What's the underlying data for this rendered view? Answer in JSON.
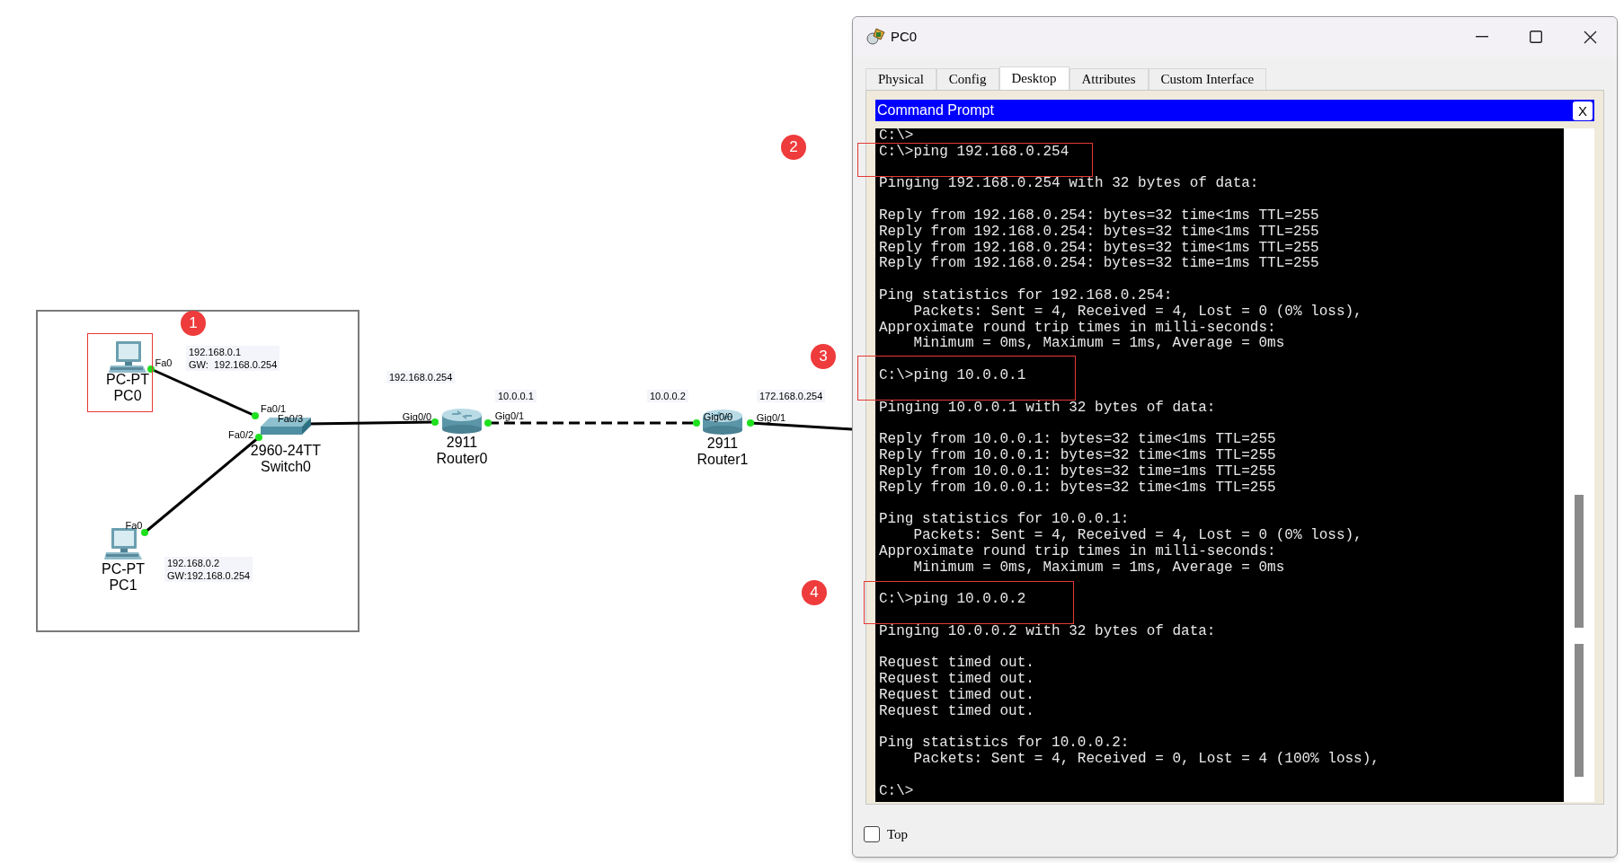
{
  "topology": {
    "devices": [
      {
        "kind": "pc",
        "model": "PC-PT",
        "name": "PC0"
      },
      {
        "kind": "pc",
        "model": "PC-PT",
        "name": "PC1"
      },
      {
        "kind": "switch",
        "model": "2960-24TT",
        "name": "Switch0"
      },
      {
        "kind": "router",
        "model": "2911",
        "name": "Router0"
      },
      {
        "kind": "router",
        "model": "2911",
        "name": "Router1"
      }
    ],
    "port_labels": [
      "Fa0",
      "Fa0/1",
      "Fa0/3",
      "Fa0/2",
      "Fa0",
      "Gig0/0",
      "Gig0/1",
      "Gig0/0",
      "Gig0/1"
    ],
    "address_notes": [
      {
        "lines": [
          "192.168.0.1",
          "GW:  192.168.0.254"
        ]
      },
      {
        "lines": [
          "192.168.0.2",
          "GW:192.168.0.254"
        ]
      },
      {
        "lines": [
          "192.168.0.254"
        ]
      },
      {
        "lines": [
          "10.0.0.1"
        ]
      },
      {
        "lines": [
          "10.0.0.2"
        ]
      },
      {
        "lines": [
          "172.168.0.254"
        ]
      }
    ]
  },
  "annotations": [
    "1",
    "2",
    "3",
    "4"
  ],
  "window": {
    "title": "PC0",
    "tabs": [
      {
        "label": "Physical",
        "selected": false
      },
      {
        "label": "Config",
        "selected": false
      },
      {
        "label": "Desktop",
        "selected": true
      },
      {
        "label": "Attributes",
        "selected": false
      },
      {
        "label": "Custom Interface",
        "selected": false
      }
    ],
    "app_title": "Command Prompt",
    "app_close": "X",
    "terminal_blocks": [
      [
        "C:\\>",
        "C:\\>ping 192.168.0.254"
      ],
      [
        "Pinging 192.168.0.254 with 32 bytes of data:"
      ],
      [
        "Reply from 192.168.0.254: bytes=32 time<1ms TTL=255",
        "Reply from 192.168.0.254: bytes=32 time<1ms TTL=255",
        "Reply from 192.168.0.254: bytes=32 time<1ms TTL=255",
        "Reply from 192.168.0.254: bytes=32 time=1ms TTL=255"
      ],
      [
        "Ping statistics for 192.168.0.254:",
        "    Packets: Sent = 4, Received = 4, Lost = 0 (0% loss),",
        "Approximate round trip times in milli-seconds:",
        "    Minimum = 0ms, Maximum = 1ms, Average = 0ms"
      ],
      [
        "C:\\>ping 10.0.0.1"
      ],
      [
        "Pinging 10.0.0.1 with 32 bytes of data:"
      ],
      [
        "Reply from 10.0.0.1: bytes=32 time<1ms TTL=255",
        "Reply from 10.0.0.1: bytes=32 time<1ms TTL=255",
        "Reply from 10.0.0.1: bytes=32 time=1ms TTL=255",
        "Reply from 10.0.0.1: bytes=32 time<1ms TTL=255"
      ],
      [
        "Ping statistics for 10.0.0.1:",
        "    Packets: Sent = 4, Received = 4, Lost = 0 (0% loss),",
        "Approximate round trip times in milli-seconds:",
        "    Minimum = 0ms, Maximum = 1ms, Average = 0ms"
      ],
      [
        "C:\\>ping 10.0.0.2"
      ],
      [
        "Pinging 10.0.0.2 with 32 bytes of data:"
      ],
      [
        "Request timed out.",
        "Request timed out.",
        "Request timed out.",
        "Request timed out."
      ],
      [
        "Ping statistics for 10.0.0.2:",
        "    Packets: Sent = 4, Received = 0, Lost = 4 (100% loss),"
      ],
      [
        "C:\\>"
      ]
    ],
    "top_option": {
      "label": "Top",
      "checked": false
    }
  }
}
